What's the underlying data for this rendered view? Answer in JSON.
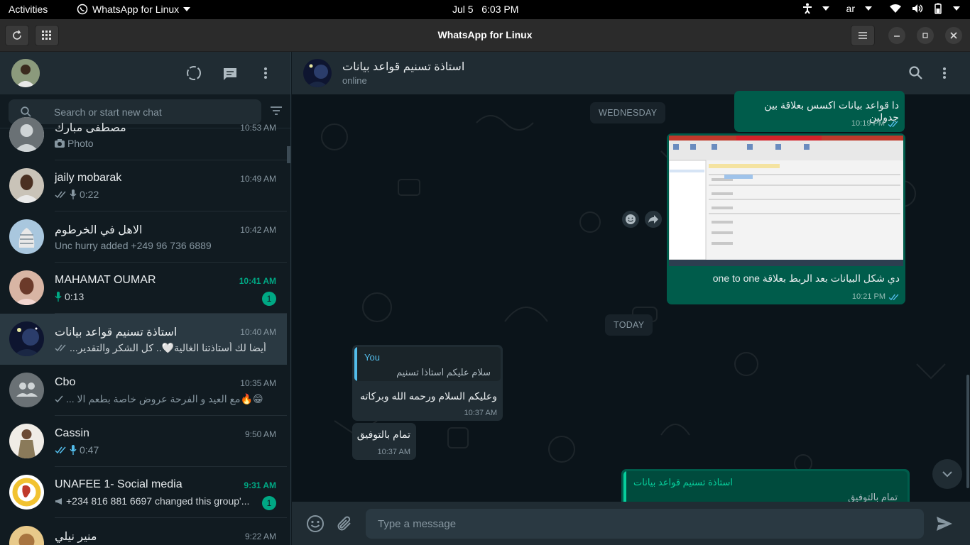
{
  "topbar": {
    "activities": "Activities",
    "app_name": "WhatsApp for Linux",
    "clock": "Jul 5   6:03 PM",
    "language": "ar"
  },
  "window": {
    "title": "WhatsApp for Linux"
  },
  "sidebar": {
    "search_placeholder": "Search or start new chat",
    "chats": [
      {
        "name": "مصطفى مبارك",
        "time": "10:53 AM",
        "preview": "Photo",
        "preview_icon": "camera-icon"
      },
      {
        "name": "jaily mobarak",
        "time": "10:49 AM",
        "preview": "0:22",
        "preview_icon": "mic-icon",
        "ticks": "read-gray"
      },
      {
        "name": "الاهل في الخرطوم",
        "time": "10:42 AM",
        "preview": "Unc hurry added +249 96 736 6889"
      },
      {
        "name": "MAHAMAT OUMAR",
        "time": "10:41 AM",
        "preview": "0:13",
        "preview_icon": "mic-icon-green",
        "unread": "1"
      },
      {
        "name": "استاذة تسنيم قواعد بيانات",
        "time": "10:40 AM",
        "preview": "أيضا لك أستاذتنا الغالية🤍.. كل الشكر والتقدير...",
        "ticks": "read-gray",
        "active": true
      },
      {
        "name": "Cbo",
        "time": "10:35 AM",
        "preview": "😁🔥مع العيد و الفرحة  عروض خاصة بطعم الا ...",
        "ticks": "sent"
      },
      {
        "name": "Cassin",
        "time": "9:50 AM",
        "preview": "0:47",
        "preview_icon": "mic-icon-blue",
        "ticks": "read-blue"
      },
      {
        "name": "UNAFEE 1- Social media",
        "time": "9:31 AM",
        "preview": "+234 816 881 6697 changed this group'...",
        "preview_icon": "megaphone-icon",
        "unread": "1"
      },
      {
        "name": "منير نيلي",
        "time": "9:22 AM",
        "preview": ""
      }
    ]
  },
  "conversation": {
    "contact_name": "استاذة تسنيم قواعد بيانات",
    "status": "online",
    "date_wednesday": "WEDNESDAY",
    "date_today": "TODAY",
    "messages": {
      "m1_text": "دا قواعد بيانات اكسس بعلاقة بين جدولين",
      "m1_time": "10:19 PM",
      "m2_caption": "دي شكل البيانات بعد الربط بعلاقة one to one",
      "m2_time": "10:21 PM",
      "m3_quote_author": "You",
      "m3_quote_text": "سلام عليكم استاذا تسنيم",
      "m3_text": "وعليكم السلام ورحمه الله وبركاته",
      "m3_time": "10:37 AM",
      "m4_text": "تمام بالتوفيق",
      "m4_time": "10:37 AM",
      "m5_quote_author": "استاذة تسنيم قواعد بيانات",
      "m5_quote_text": "تمام بالتوفيق"
    },
    "composer_placeholder": "Type a message"
  },
  "colors": {
    "accent": "#00a884",
    "outgoing_bubble": "#005c4b",
    "incoming_bubble": "#202c33",
    "read_tick": "#53bdeb"
  }
}
